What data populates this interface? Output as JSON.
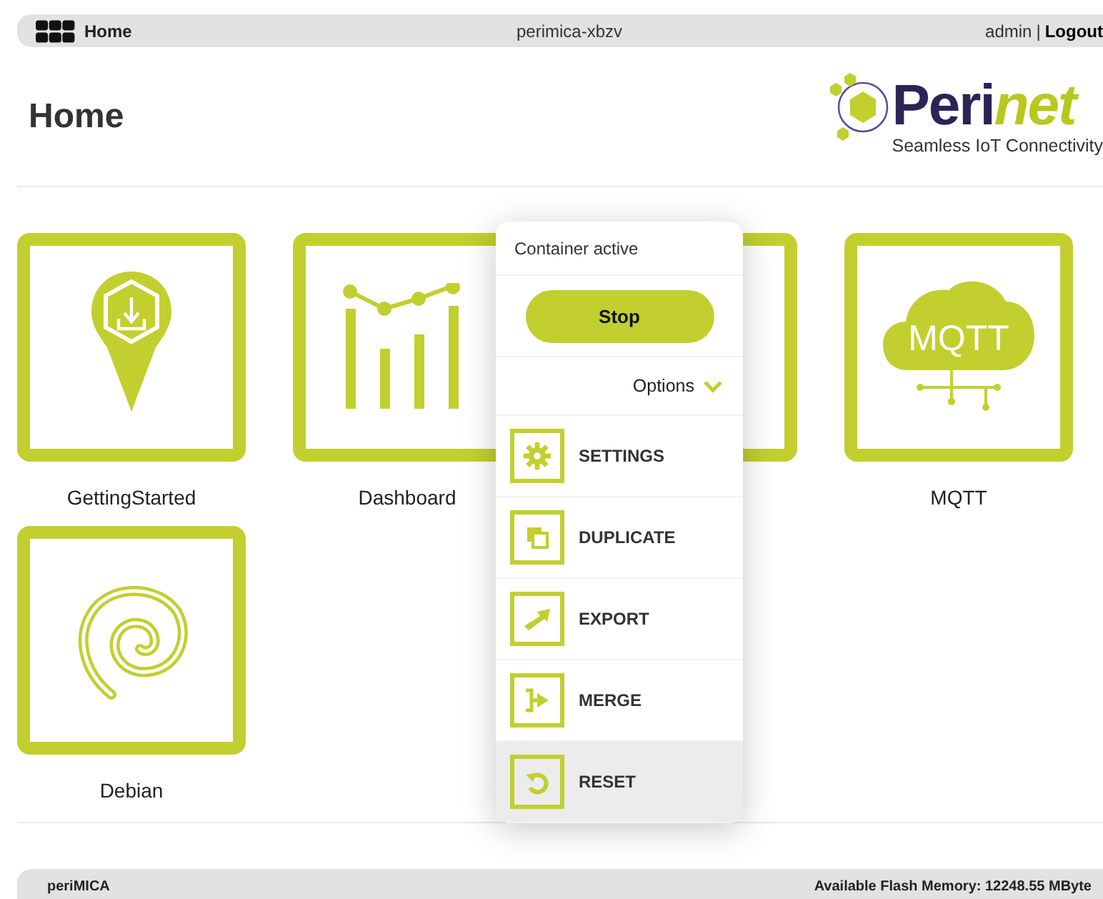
{
  "top_bar": {
    "home_label": "Home",
    "device": "perimica-xbzv",
    "user": "admin",
    "separator": "|",
    "logout": "Logout"
  },
  "page_title": "Home",
  "logo": {
    "name_parts": [
      "Peri",
      "net"
    ],
    "tagline": "Seamless IoT Connectivity"
  },
  "apps": [
    {
      "kind": "download-pin",
      "name": "GettingStarted"
    },
    {
      "kind": "chart",
      "name": "Dashboard"
    },
    {
      "kind": "covered"
    },
    {
      "kind": "cloud",
      "name": "MQTT",
      "icon_text": "MQTT"
    },
    {
      "kind": "spiral",
      "name": "Debian"
    }
  ],
  "popup": {
    "status": "Container active",
    "primary_button": "Stop",
    "options_label": "Options",
    "options_expanded": true,
    "items": [
      {
        "kind": "gear",
        "label": "SETTINGS",
        "selected": false
      },
      {
        "kind": "copy",
        "label": "DUPLICATE",
        "selected": false
      },
      {
        "kind": "arrow",
        "label": "EXPORT",
        "selected": false
      },
      {
        "kind": "merge",
        "label": "MERGE",
        "selected": false
      },
      {
        "kind": "undo",
        "label": "RESET",
        "selected": true
      }
    ]
  },
  "footer": {
    "product": "periMICA",
    "flash": "Available Flash Memory: 12248.55 MByte"
  }
}
